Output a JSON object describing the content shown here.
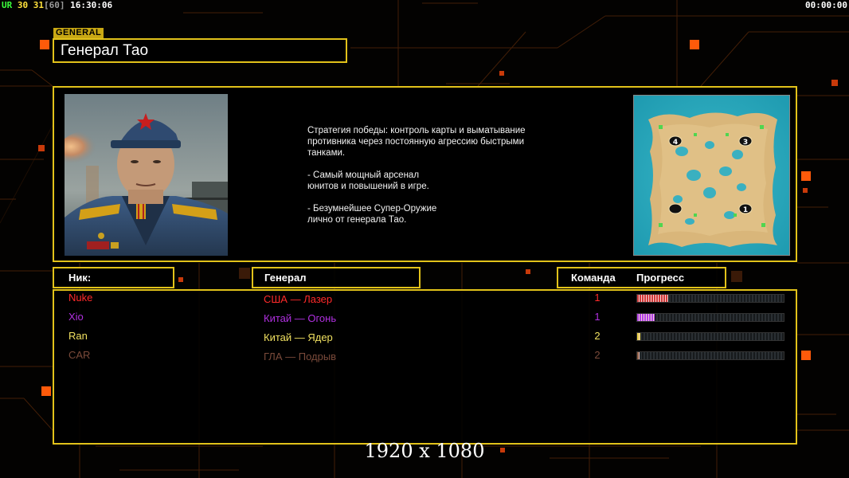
{
  "topbar": {
    "ur": "UR",
    "fps_a": "30",
    "fps_b": "31",
    "fps_c": "[60]",
    "clock": "16:30:06",
    "timer": "00:00:00"
  },
  "general": {
    "tag": "GENERAL",
    "name": "Генерал Тао",
    "description": [
      "Стратегия победы: контроль карты и выматывание\n противника через постоянную агрессию быстрыми\n танками.",
      "- Самый мощный арсенал\nюнитов и повышений в игре.",
      "- Безумнейшее Супер-Оружие\nлично от генерала Тао."
    ]
  },
  "minimap": {
    "start_positions": [
      "4",
      "3",
      "1"
    ]
  },
  "table": {
    "headers": {
      "nick": "Ник:",
      "general": "Генерал",
      "team": "Команда",
      "progress": "Прогресс"
    },
    "players": [
      {
        "nick": "Nuke",
        "general": "США — Лазер",
        "team": "1",
        "progress": 0.21,
        "color": "#ff2a2a",
        "bar_color": "#d23a3a"
      },
      {
        "nick": "Xio",
        "general": "Китай — Огонь",
        "team": "1",
        "progress": 0.12,
        "color": "#b030e0",
        "bar_color": "#b040e8"
      },
      {
        "nick": "Ran",
        "general": "Китай — Ядер",
        "team": "2",
        "progress": 0.02,
        "color": "#f0e060",
        "bar_color": "#e8d040"
      },
      {
        "nick": "CAR",
        "general": "ГЛА — Подрыв",
        "team": "2",
        "progress": 0.01,
        "color": "#7a4a3a",
        "bar_color": "#8a5a40"
      }
    ]
  },
  "resolution_label": "1920 x 1080",
  "colors": {
    "frame": "#e2c21a",
    "accent_orange": "#ff5a0a",
    "grid_line": "#5a2a0a"
  }
}
